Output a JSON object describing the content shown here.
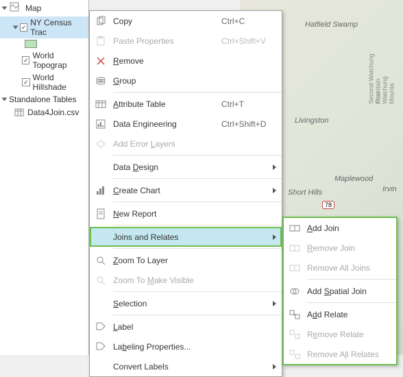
{
  "toc": {
    "map_label": "Map",
    "layer1": "NY Census Trac",
    "layer2": "World Topograp",
    "layer3": "World Hillshade",
    "group": "Standalone Tables",
    "table1": "Data4Join.csv"
  },
  "menu": {
    "copy": "Copy",
    "copy_sc": "Ctrl+C",
    "paste": "Paste Properties",
    "paste_sc": "Ctrl+Shift+V",
    "remove": "Remove",
    "group": "Group",
    "attr": "Attribute Table",
    "attr_sc": "Ctrl+T",
    "de": "Data Engineering",
    "de_sc": "Ctrl+Shift+D",
    "errlayers": "Add Error Layers",
    "datadesign": "Data Design",
    "chart": "Create Chart",
    "report": "New Report",
    "joins": "Joins and Relates",
    "zoomlayer": "Zoom To Layer",
    "zoomvis": "Zoom To Make Visible",
    "selection": "Selection",
    "label": "Label",
    "labelprops": "Labeling Properties...",
    "convlabels": "Convert Labels"
  },
  "submenu": {
    "addjoin": "Add Join",
    "removejoin": "Remove Join",
    "removealljoins": "Remove All Joins",
    "spatialjoin": "Add Spatial Join",
    "addrelate": "Add Relate",
    "removerelate": "Remove Relate",
    "removeallrelates": "Remove All Relates"
  },
  "map_labels": {
    "hatfield": "Hatfield Swamp",
    "livingston": "Livingston",
    "shorthills": "Short Hills",
    "maplewood": "Maplewood",
    "irv": "Irvin",
    "road1": "Second Watchung Mountain",
    "road2": "First Watchung Mounta",
    "hwy": "78"
  }
}
